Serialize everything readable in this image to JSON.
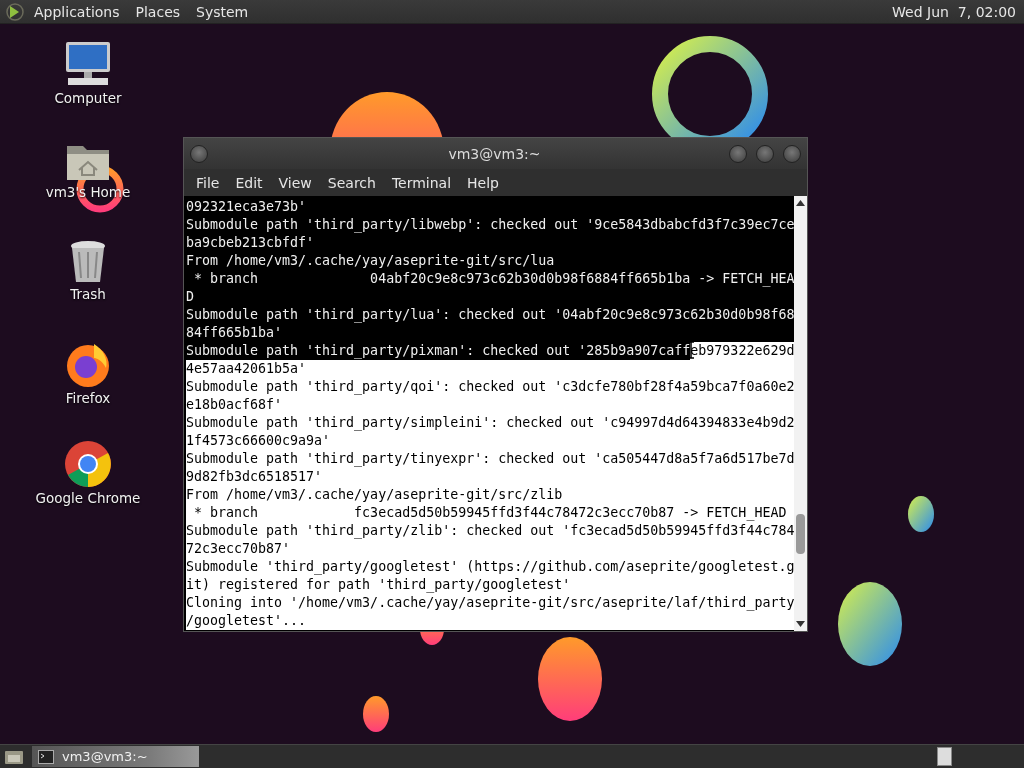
{
  "top_panel": {
    "menus": [
      "Applications",
      "Places",
      "System"
    ],
    "clock": "Wed Jun  7, 02:00"
  },
  "desktop_icons": [
    {
      "label": "Computer",
      "kind": "computer"
    },
    {
      "label": "vm3's Home",
      "kind": "home"
    },
    {
      "label": "Trash",
      "kind": "trash"
    },
    {
      "label": "Firefox",
      "kind": "firefox"
    },
    {
      "label": "Google Chrome",
      "kind": "chrome"
    }
  ],
  "terminal": {
    "title": "vm3@vm3:~",
    "menu": [
      "File",
      "Edit",
      "View",
      "Search",
      "Terminal",
      "Help"
    ],
    "lines": [
      {
        "segments": [
          {
            "text": "092321eca3e73b'",
            "selected": false
          }
        ]
      },
      {
        "segments": [
          {
            "text": "Submodule path 'third_party/libwebp': checked out '9ce5843dbabcfd3f7c39ec7ce",
            "selected": false
          }
        ]
      },
      {
        "segments": [
          {
            "text": "ba9cbeb213cbfdf'",
            "selected": false
          }
        ]
      },
      {
        "segments": [
          {
            "text": "From /home/vm3/.cache/yay/aseprite-git/src/lua",
            "selected": false
          }
        ]
      },
      {
        "segments": [
          {
            "text": " * branch              04abf20c9e8c973c62b30d0b98f6884ff665b1ba -> FETCH_HEA",
            "selected": false
          }
        ]
      },
      {
        "segments": [
          {
            "text": "D",
            "selected": false
          }
        ]
      },
      {
        "segments": [
          {
            "text": "Submodule path 'third_party/lua': checked out '04abf20c9e8c973c62b30d0b98f68",
            "selected": false
          }
        ]
      },
      {
        "segments": [
          {
            "text": "84ff665b1ba'",
            "selected": false
          }
        ]
      },
      {
        "segments": [
          {
            "text": "Submodule path 'third_party/pixman': checked out '285b9a907caff",
            "selected": false
          },
          {
            "text": "eb979322e629d",
            "selected": true
          }
        ]
      },
      {
        "segments": [
          {
            "text": "4e57aa42061b5a'",
            "selected": true
          }
        ]
      },
      {
        "segments": [
          {
            "text": "Submodule path 'third_party/qoi': checked out 'c3dcfe780bf28f4a59bca7f0a60e2",
            "selected": true
          }
        ]
      },
      {
        "segments": [
          {
            "text": "e18b0acf68f'",
            "selected": true
          }
        ]
      },
      {
        "segments": [
          {
            "text": "Submodule path 'third_party/simpleini': checked out 'c94997d4d64394833e4b9d2",
            "selected": true
          }
        ]
      },
      {
        "segments": [
          {
            "text": "1f4573c66600c9a9a'",
            "selected": true
          }
        ]
      },
      {
        "segments": [
          {
            "text": "Submodule path 'third_party/tinyexpr': checked out 'ca505447d8a5f7a6d517be7d",
            "selected": true
          }
        ]
      },
      {
        "segments": [
          {
            "text": "9d82fb3dc6518517'",
            "selected": true
          }
        ]
      },
      {
        "segments": [
          {
            "text": "From /home/vm3/.cache/yay/aseprite-git/src/zlib",
            "selected": true
          }
        ]
      },
      {
        "segments": [
          {
            "text": " * branch            fc3ecad5d50b59945ffd3f44c78472c3ecc70b87 -> FETCH_HEAD",
            "selected": true
          }
        ]
      },
      {
        "segments": [
          {
            "text": "Submodule path 'third_party/zlib': checked out 'fc3ecad5d50b59945ffd3f44c784",
            "selected": true
          }
        ]
      },
      {
        "segments": [
          {
            "text": "72c3ecc70b87'",
            "selected": true
          }
        ]
      },
      {
        "segments": [
          {
            "text": "Submodule 'third_party/googletest' (https://github.com/aseprite/googletest.g",
            "selected": true
          }
        ]
      },
      {
        "segments": [
          {
            "text": "it) registered for path 'third_party/googletest'",
            "selected": true
          }
        ]
      },
      {
        "segments": [
          {
            "text": "Cloning into '/home/vm3/.cache/yay/aseprite-git/src/aseprite/laf/third_party",
            "selected": true
          }
        ]
      },
      {
        "segments": [
          {
            "text": "/googletest'...",
            "selected": true
          }
        ]
      }
    ]
  },
  "taskbar": {
    "windows": [
      {
        "label": "vm3@vm3:~",
        "selected": true
      }
    ]
  }
}
